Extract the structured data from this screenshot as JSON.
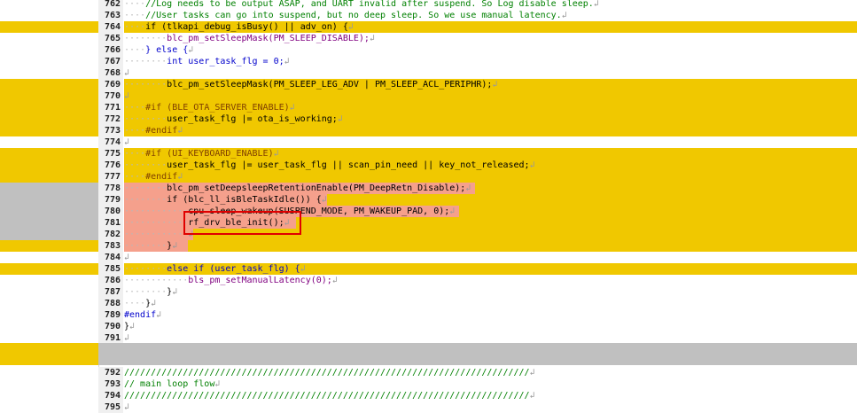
{
  "editor": {
    "lines": [
      {
        "num": "762",
        "bg": "none",
        "hl": false,
        "indent": "····",
        "text": "//Log needs to be output ASAP, and UART invalid after suspend. So Log disable sleep.",
        "cls": "cm"
      },
      {
        "num": "763",
        "bg": "none",
        "hl": false,
        "indent": "····",
        "text": "//User tasks can go into suspend, but no deep sleep. So we use manual latency.",
        "cls": "cm"
      },
      {
        "num": "764",
        "bg": "y",
        "hl": false,
        "indent": "····",
        "text": "if (tlkapi_debug_isBusy() || adv_on) {",
        "cls": "tx"
      },
      {
        "num": "765",
        "bg": "none",
        "hl": false,
        "indent": "········",
        "text": "blc_pm_setSleepMask(PM_SLEEP_DISABLE);",
        "cls": "fn"
      },
      {
        "num": "766",
        "bg": "none",
        "hl": false,
        "indent": "····",
        "text": "} else {",
        "cls": "kw"
      },
      {
        "num": "767",
        "bg": "none",
        "hl": false,
        "indent": "········",
        "text": "int user_task_flg = 0;",
        "cls": "kw"
      },
      {
        "num": "768",
        "bg": "none",
        "hl": false,
        "indent": "",
        "text": "",
        "cls": "tx"
      },
      {
        "num": "769",
        "bg": "y",
        "hl": false,
        "indent": "········",
        "text": "blc_pm_setSleepMask(PM_SLEEP_LEG_ADV | PM_SLEEP_ACL_PERIPHR);",
        "cls": "tx"
      },
      {
        "num": "770",
        "bg": "y",
        "hl": false,
        "indent": "",
        "text": "",
        "cls": "tx"
      },
      {
        "num": "771",
        "bg": "y",
        "hl": false,
        "indent": "····",
        "text": "#if (BLE_OTA_SERVER_ENABLE)",
        "cls": "pp"
      },
      {
        "num": "772",
        "bg": "y",
        "hl": false,
        "indent": "········",
        "text": "user_task_flg |= ota_is_working;",
        "cls": "tx"
      },
      {
        "num": "773",
        "bg": "y",
        "hl": false,
        "indent": "····",
        "text": "#endif",
        "cls": "pp"
      },
      {
        "num": "774",
        "bg": "none",
        "hl": false,
        "indent": "",
        "text": "",
        "cls": "tx"
      },
      {
        "num": "775",
        "bg": "y",
        "hl": false,
        "indent": "····",
        "text": "#if (UI_KEYBOARD_ENABLE)",
        "cls": "pp"
      },
      {
        "num": "776",
        "bg": "y",
        "hl": false,
        "indent": "········",
        "text": "user_task_flg |= user_task_flg || scan_pin_need || key_not_released;",
        "cls": "tx"
      },
      {
        "num": "777",
        "bg": "y",
        "hl": false,
        "indent": "····",
        "text": "#endif",
        "cls": "pp"
      },
      {
        "num": "778",
        "bg": "g",
        "hl": true,
        "indent": "········",
        "text": "blc_pm_setDeepsleepRetentionEnable(PM_DeepRetn_Disable);",
        "cls": "tx"
      },
      {
        "num": "779",
        "bg": "g",
        "hl": true,
        "indent": "········",
        "text": "if (blc_ll_isBleTaskIdle()) {",
        "cls": "tx"
      },
      {
        "num": "780",
        "bg": "g",
        "hl": true,
        "indent": "············",
        "text": "cpu_sleep_wakeup(SUSPEND_MODE, PM_WAKEUP_PAD, 0);",
        "cls": "tx"
      },
      {
        "num": "781",
        "bg": "g",
        "hl": true,
        "indent": "············",
        "text": "rf_drv_ble_init();",
        "cls": "tx"
      },
      {
        "num": "782",
        "bg": "g",
        "hl": true,
        "indent": "············",
        "text": "",
        "cls": "tx"
      },
      {
        "num": "783",
        "bg": "y",
        "hl": true,
        "indent": "········",
        "text": "}",
        "cls": "tx"
      },
      {
        "num": "784",
        "bg": "none",
        "hl": false,
        "indent": "",
        "text": "",
        "cls": "tx"
      },
      {
        "num": "785",
        "bg": "y",
        "hl": false,
        "indent": "········",
        "text": "else if (user_task_flg) {",
        "cls": "kw"
      },
      {
        "num": "786",
        "bg": "none",
        "hl": false,
        "indent": "············",
        "text": "bls_pm_setManualLatency(0);",
        "cls": "fn"
      },
      {
        "num": "787",
        "bg": "none",
        "hl": false,
        "indent": "········",
        "text": "}",
        "cls": "tx"
      },
      {
        "num": "788",
        "bg": "none",
        "hl": false,
        "indent": "····",
        "text": "}",
        "cls": "tx"
      },
      {
        "num": "789",
        "bg": "none",
        "hl": false,
        "indent": "",
        "text": "#endif",
        "cls": "kw"
      },
      {
        "num": "790",
        "bg": "none",
        "hl": false,
        "indent": "",
        "text": "}",
        "cls": "tx"
      },
      {
        "num": "791",
        "bg": "none",
        "hl": false,
        "indent": "",
        "text": "",
        "cls": "tx"
      },
      {
        "num": "792",
        "bg": "none",
        "hl": false,
        "indent": "",
        "text": "////////////////////////////////////////////////////////////////////////////",
        "cls": "cm"
      },
      {
        "num": "793",
        "bg": "none",
        "hl": false,
        "indent": "",
        "text": "// main loop flow",
        "cls": "cm"
      },
      {
        "num": "794",
        "bg": "none",
        "hl": false,
        "indent": "",
        "text": "////////////////////////////////////////////////////////////////////////////",
        "cls": "cm"
      },
      {
        "num": "795",
        "bg": "none",
        "hl": false,
        "indent": "",
        "text": "",
        "cls": "tx"
      }
    ],
    "return_mark": "↲",
    "highlight_note": "rf_drv_ble_init();"
  }
}
